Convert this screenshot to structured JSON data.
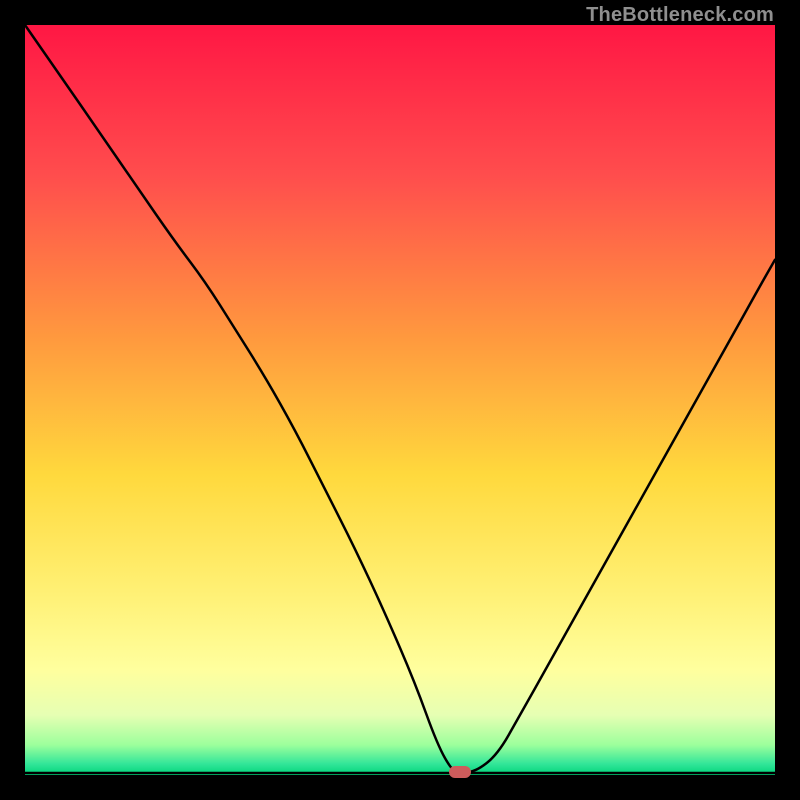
{
  "watermark": "TheBottleneck.com",
  "chart_data": {
    "type": "line",
    "title": "",
    "xlabel": "",
    "ylabel": "",
    "xlim": [
      0,
      100
    ],
    "ylim": [
      0,
      100
    ],
    "x": [
      0,
      5,
      10,
      15,
      20,
      24,
      28,
      32,
      36,
      40,
      44,
      48,
      52,
      55,
      57,
      58,
      60,
      63,
      66,
      70,
      74,
      78,
      82,
      86,
      90,
      94,
      98,
      100
    ],
    "values": [
      100,
      92.8,
      85.6,
      78.3,
      71.1,
      65.8,
      59.5,
      53.1,
      46.0,
      38.1,
      30.2,
      21.6,
      12.3,
      4.0,
      0.5,
      0.4,
      0.4,
      2.7,
      8.0,
      15.1,
      22.3,
      29.4,
      36.6,
      43.7,
      50.9,
      58.0,
      65.2,
      68.7
    ],
    "marker": {
      "x": 58,
      "y": 0.4,
      "color": "#cd5c5c"
    },
    "background": {
      "type": "vertical-gradient",
      "stops": [
        {
          "offset": 0,
          "color": "#ff1744"
        },
        {
          "offset": 20,
          "color": "#ff4d4d"
        },
        {
          "offset": 42,
          "color": "#ff9a3e"
        },
        {
          "offset": 60,
          "color": "#ffd93d"
        },
        {
          "offset": 76,
          "color": "#fff176"
        },
        {
          "offset": 86,
          "color": "#ffff9e"
        },
        {
          "offset": 92,
          "color": "#e6ffb3"
        },
        {
          "offset": 96,
          "color": "#9cff9c"
        },
        {
          "offset": 98.5,
          "color": "#33e699"
        },
        {
          "offset": 100,
          "color": "#00d47a"
        }
      ]
    }
  }
}
